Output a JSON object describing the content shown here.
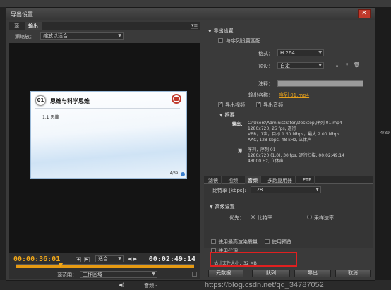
{
  "dialog": {
    "title": "导出设置"
  },
  "background": {
    "right_text": "4/89",
    "speaker_glyph": "◀)",
    "bottom_item": "音频 -"
  },
  "left": {
    "tabs": [
      "源",
      "输出"
    ],
    "menu_glyph": "▾≡",
    "scale_label": "源缩放：",
    "scale_value": "缩放以适合",
    "slide": {
      "number": "01",
      "heading": "思维与科学思维",
      "bullet": "1.1   思维",
      "page": "4/89"
    },
    "timecode_current": "00:00:36:01",
    "timecode_duration": "00:02:49:14",
    "fit_value": "适合",
    "range_label": "源范围：",
    "range_value": "工作区域"
  },
  "export": {
    "header": "导出设置",
    "match_sequence": "与序列设置匹配",
    "format_label": "格式：",
    "format_value": "H.264",
    "preset_label": "预设：",
    "preset_value": "自定",
    "notes_label": "注释：",
    "output_name_label": "输出名称：",
    "output_name_value": "序列 01.mp4",
    "export_video": "导出视频",
    "export_audio": "导出音频",
    "summary_header": "摘要",
    "output_label": "输出：",
    "output_lines": [
      "C:\\Users\\Administrator\\Desktop\\序列 01.mp4",
      "1280x720, 25 fps, 逐行",
      "VBR，1次，目标 1.50 Mbps，最大 2.00 Mbps",
      "AAC, 128 kbps, 48 kHz, 立体声"
    ],
    "source_label": "源：",
    "source_lines": [
      "序列，序列 01",
      "1280x720 (1.0), 30 fps, 逐行扫描, 00:02:49:14",
      "48000 Hz, 立体声"
    ]
  },
  "tabs_right": [
    "滤镜",
    "视频",
    "音频",
    "多路复用器",
    "FTP"
  ],
  "audio": {
    "bitrate_label": "比特率 [kbps]:",
    "bitrate_value": "128",
    "advanced_header": "高级设置",
    "priority_label": "优先：",
    "priority_bitrate": "比特率",
    "priority_samplerate": "采样速率"
  },
  "options": {
    "max_render_quality": "使用最高渲染质量",
    "use_previews": "使用预览",
    "use_proxies": "使用代理"
  },
  "estimate": {
    "label": "估计文件大小：",
    "value": "32 MB"
  },
  "buttons": {
    "metadata": "元数据...",
    "queue": "队列",
    "export": "导出",
    "cancel": "取消"
  },
  "watermark": "https://blog.csdn.net/qq_34787052"
}
